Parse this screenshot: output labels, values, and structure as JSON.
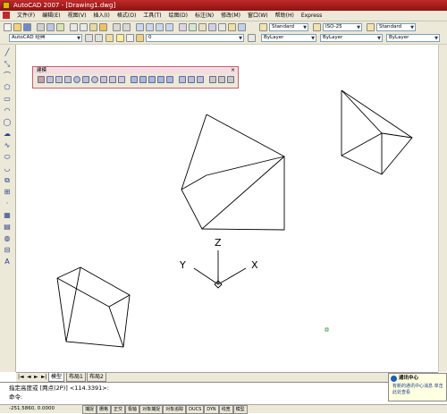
{
  "window": {
    "title": "AutoCAD 2007 - [Drawing1.dwg]"
  },
  "menu": {
    "items": [
      "文件(F)",
      "编辑(E)",
      "视图(V)",
      "插入(I)",
      "格式(O)",
      "工具(T)",
      "绘图(D)",
      "标注(N)",
      "修改(M)",
      "窗口(W)",
      "帮助(H)",
      "Express"
    ]
  },
  "toolbar": {
    "text_style": "Standard",
    "dim_style": "ISO-25",
    "table_style": "Standard",
    "workspace": "AutoCAD 经典",
    "layer": "0",
    "color": "ByLayer",
    "linetype": "ByLayer",
    "lineweight": "ByLayer"
  },
  "modeling_toolbar": {
    "title": "建模"
  },
  "ucs_icon": {
    "x": "X",
    "y": "Y",
    "z": "Z"
  },
  "tabs": {
    "model": "模型",
    "layout1": "布局1",
    "layout2": "布局2"
  },
  "command": {
    "line1": "指定高度或 [两点(2P)] <114.3391>:",
    "line2": "命令:"
  },
  "balloon": {
    "title": "通讯中心",
    "body": "有新的通讯中心消息 单击此处查看"
  },
  "status": {
    "coords": "-251.5860, 0.0000",
    "buttons": [
      "捕捉",
      "栅格",
      "正交",
      "极轴",
      "对象捕捉",
      "对象追踪",
      "DUCS",
      "DYN",
      "线宽",
      "模型"
    ]
  },
  "colors": {
    "title_bar": "#8e1212",
    "chrome": "#ece9d8",
    "accent": "#2a3e8a"
  }
}
